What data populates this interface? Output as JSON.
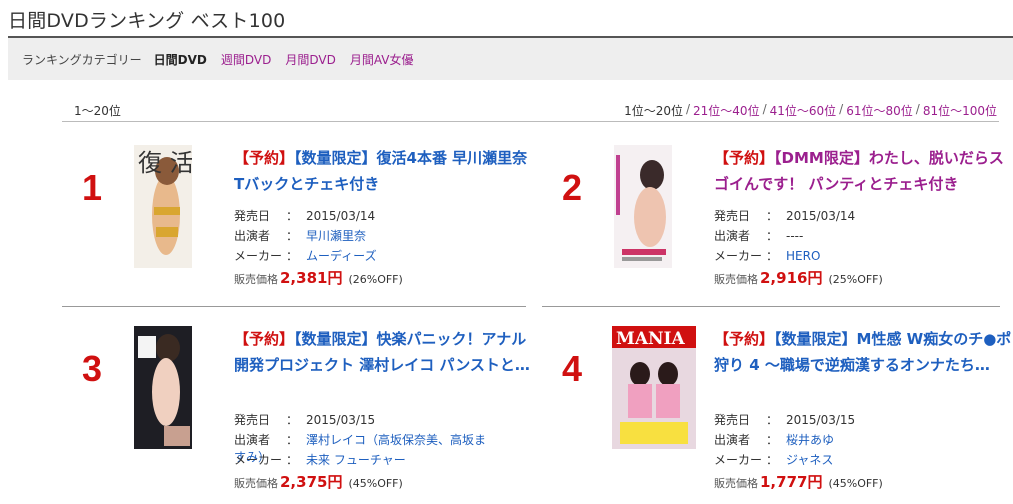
{
  "page": {
    "title": "日間DVDランキング ベスト100"
  },
  "category_bar": {
    "label": "ランキングカテゴリー",
    "current": "日間DVD",
    "links": [
      "週間DVD",
      "月間DVD",
      "月間AV女優"
    ]
  },
  "range": {
    "label": "1〜20位",
    "current": "1位〜20位",
    "links": [
      "21位〜40位",
      "41位〜60位",
      "61位〜80位",
      "81位〜100位"
    ]
  },
  "labels": {
    "release": "発売日",
    "cast": "出演者",
    "maker": "メーカー",
    "price": "販売価格",
    "colon": "："
  },
  "items": [
    {
      "rank": "1",
      "tag": "【予約】",
      "title": "【数量限定】復活4本番 早川瀬里奈 Tバックとチェキ付き",
      "release": "2015/03/14",
      "cast": "早川瀬里奈",
      "maker": "ムーディーズ",
      "price": "2,381円",
      "off": "(26%OFF)",
      "thumb_text": "復 活"
    },
    {
      "rank": "2",
      "tag": "【予約】",
      "title": "【DMM限定】わたし、脱いだらスゴイんです！ パンティとチェキ付き",
      "release": "2015/03/14",
      "cast": "----",
      "maker": "HERO",
      "price": "2,916円",
      "off": "(25%OFF)",
      "thumb_text": ""
    },
    {
      "rank": "3",
      "tag": "【予約】",
      "title": "【数量限定】快楽パニック！アナル開発プロジェクト 澤村レイコ パンストと…",
      "release": "2015/03/15",
      "cast": "澤村レイコ（高坂保奈美、高坂ますみ）",
      "maker": "未来 フューチャー",
      "price": "2,375円",
      "off": "(45%OFF)",
      "thumb_text": ""
    },
    {
      "rank": "4",
      "tag": "【予約】",
      "title": "【数量限定】M性感 W痴女のチ●ポ狩り 4 〜職場で逆痴漢するオンナたち…",
      "release": "2015/03/15",
      "cast": "桜井あゆ",
      "maker": "ジャネス",
      "price": "1,777円",
      "off": "(45%OFF)",
      "thumb_text": "MANIA"
    }
  ]
}
